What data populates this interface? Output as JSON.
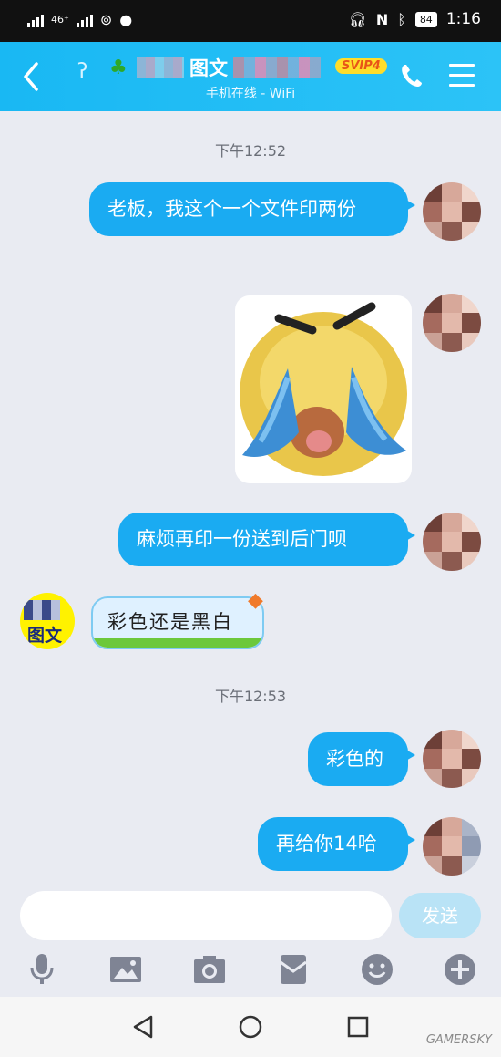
{
  "status_bar": {
    "network": "46⁺",
    "battery": "84",
    "time": "1:16"
  },
  "header": {
    "contact_name": "图文",
    "badge": "SVIP4",
    "status": "手机在线 - WiFi",
    "icons": [
      "back-arrow-icon",
      "ear-icon",
      "leaf-icon",
      "phone-icon",
      "menu-icon"
    ]
  },
  "chat": {
    "timestamps": [
      "下午12:52",
      "下午12:53"
    ],
    "messages": [
      {
        "from": "me",
        "text": "老板，我这个一个文件印两份"
      },
      {
        "from": "me",
        "type": "sticker",
        "sticker": "crying-face-sticker"
      },
      {
        "from": "me",
        "text": "麻烦再印一份送到后门呗"
      },
      {
        "from": "other",
        "text": "彩色还是黑白",
        "avatar_text": "图文"
      },
      {
        "from": "me",
        "text": "彩色的"
      },
      {
        "from": "me",
        "text": "再给你14哈"
      }
    ]
  },
  "composer": {
    "input_value": "",
    "send_label": "发送"
  },
  "toolbar": [
    "microphone-icon",
    "image-icon",
    "camera-icon",
    "red-packet-icon",
    "emoji-icon",
    "plus-icon"
  ],
  "navbar": [
    "back-triangle-icon",
    "home-circle-icon",
    "recents-square-icon"
  ],
  "watermark": "GAMERSKY",
  "colors": {
    "header": "#19b8f3",
    "bubble": "#1aabf2",
    "background": "#e9ebf2",
    "badge": "#ffdd2b"
  }
}
